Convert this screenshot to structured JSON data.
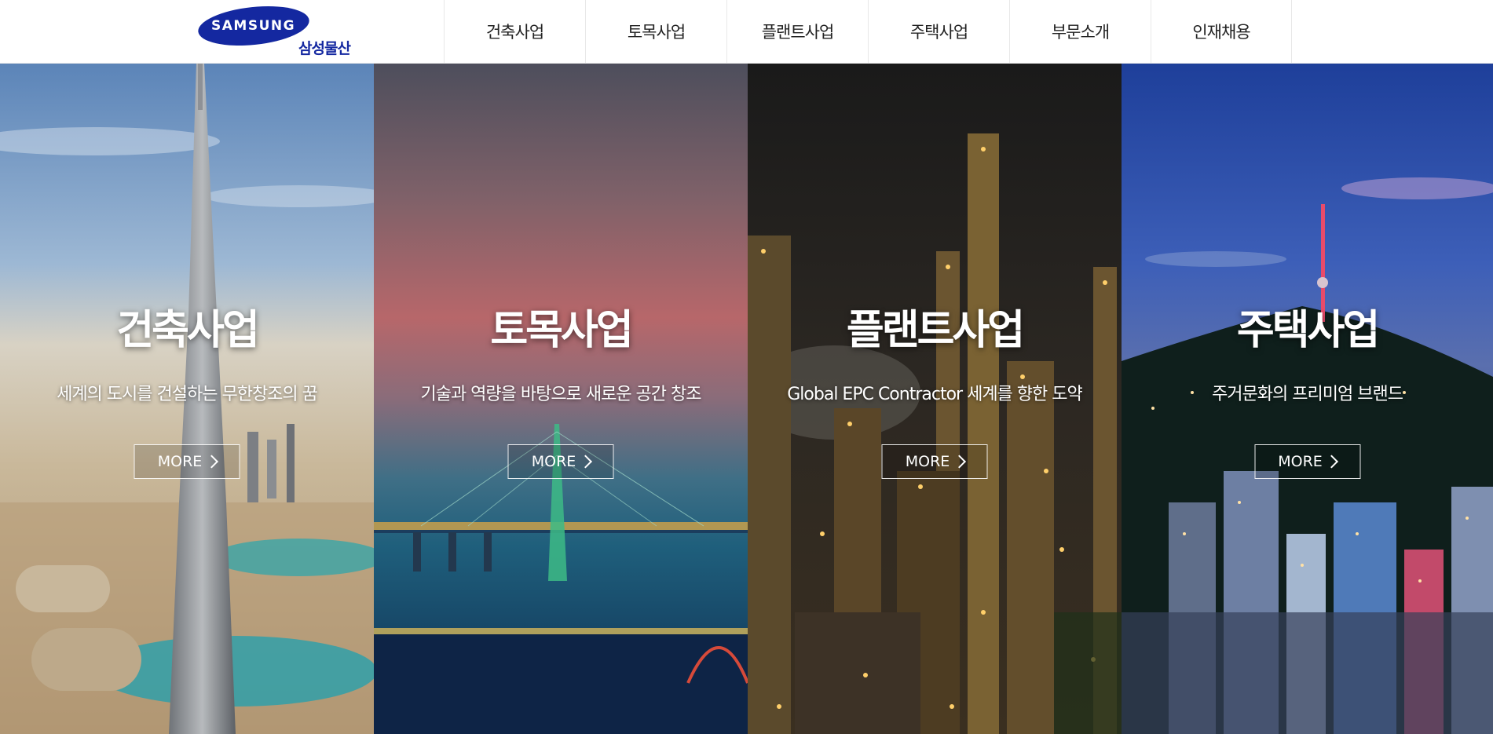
{
  "header": {
    "logo_wordmark": "SAMSUNG",
    "logo_subtitle": "삼성물산",
    "brand_color": "#1428a0",
    "nav": [
      "건축사업",
      "토목사업",
      "플랜트사업",
      "주택사업",
      "부문소개",
      "인재채용"
    ]
  },
  "panels": [
    {
      "title": "건축사업",
      "description": "세계의 도시를 건설하는 무한창조의 꿈",
      "button": "MORE"
    },
    {
      "title": "토목사업",
      "description": "기술과 역량을 바탕으로 새로운 공간 창조",
      "button": "MORE"
    },
    {
      "title": "플랜트사업",
      "description": "Global EPC Contractor 세계를 향한 도약",
      "button": "MORE"
    },
    {
      "title": "주택사업",
      "description": "주거문화의 프리미엄 브랜드",
      "button": "MORE"
    }
  ]
}
